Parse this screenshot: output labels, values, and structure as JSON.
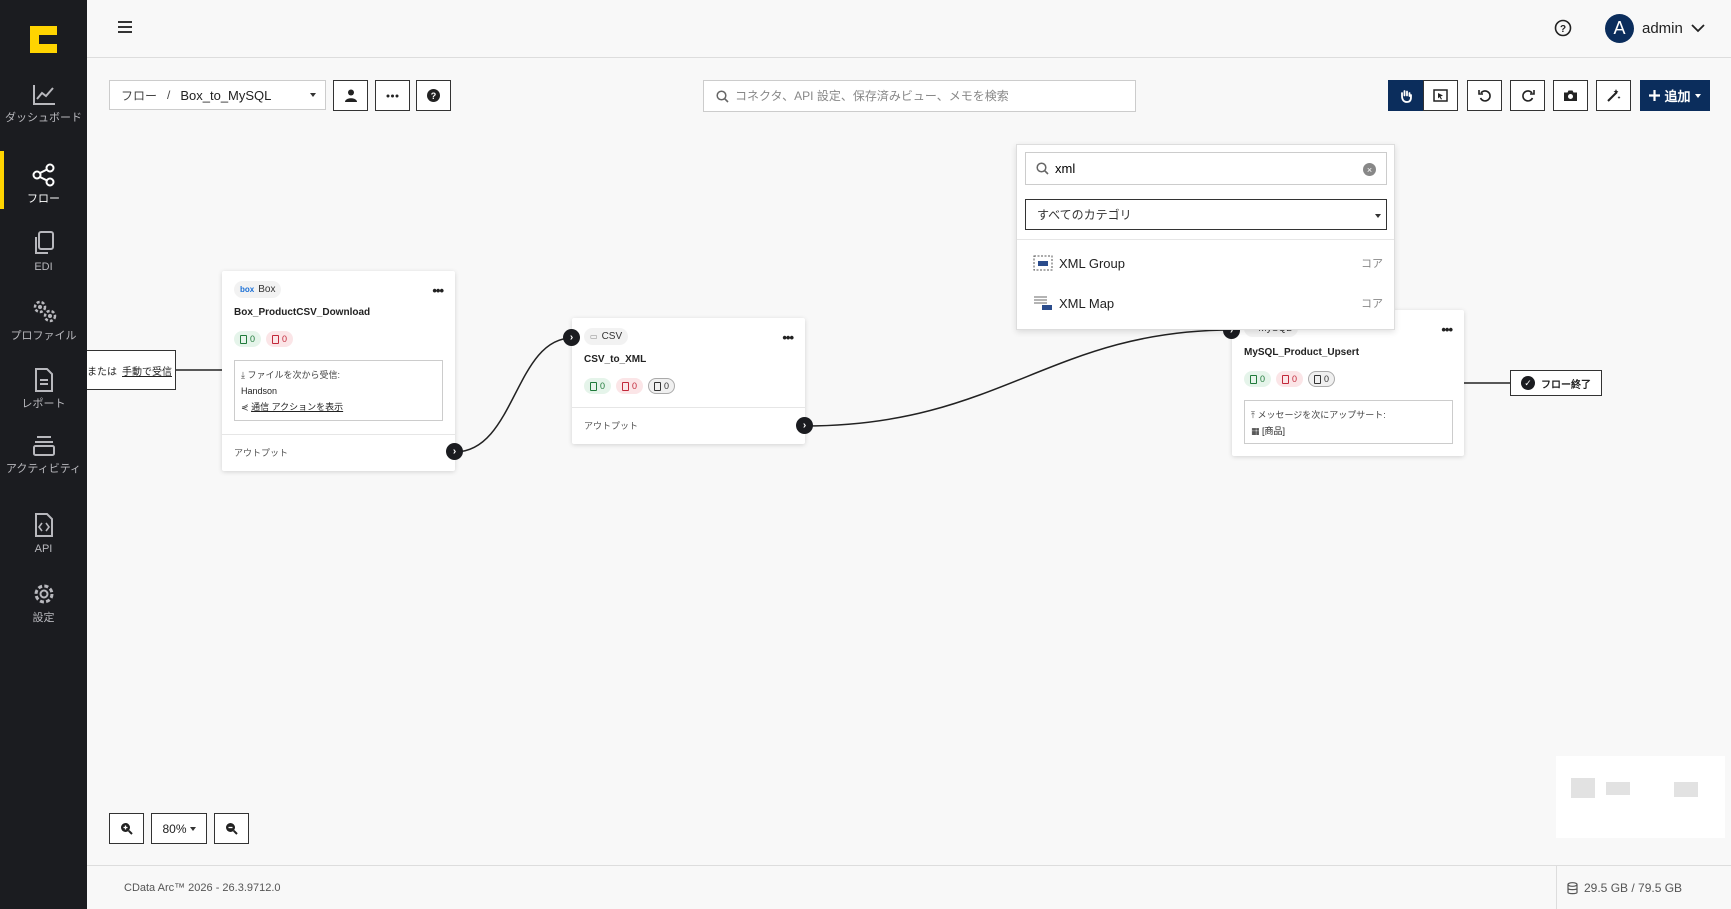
{
  "sidebar": {
    "items": [
      {
        "label": "ダッシュボード",
        "icon": "chart-line-icon"
      },
      {
        "label": "フロー",
        "icon": "share-nodes-icon",
        "active": true
      },
      {
        "label": "EDI",
        "icon": "documents-icon"
      },
      {
        "label": "プロファイル",
        "icon": "gears-icon"
      },
      {
        "label": "レポート",
        "icon": "report-icon"
      },
      {
        "label": "アクティビティ",
        "icon": "activity-stack-icon"
      },
      {
        "label": "API",
        "icon": "api-file-icon"
      },
      {
        "label": "設定",
        "icon": "gear-icon"
      }
    ]
  },
  "header": {
    "user": {
      "initial": "A",
      "name": "admin"
    }
  },
  "toolbar": {
    "breadcrumb_root": "フロー",
    "breadcrumb_sep": "/",
    "flow_name": "Box_to_MySQL",
    "search_placeholder": "コネクタ、API 設定、保存済みビュー、メモを検索",
    "add_label": "追加"
  },
  "canvas": {
    "trigger": {
      "prefix": "または",
      "link": "手動で受信"
    },
    "nodes": [
      {
        "connector": "Box",
        "title": "Box_ProductCSV_Download",
        "badges": {
          "ok": "0",
          "err": "0"
        },
        "info_line1": "ファイルを次から受信:",
        "info_line2": "Handson",
        "info_link": "通信 アクションを表示",
        "output": "アウトプット"
      },
      {
        "connector": "CSV",
        "title": "CSV_to_XML",
        "badges": {
          "ok": "0",
          "err": "0",
          "neutral": "0"
        },
        "output": "アウトプット"
      },
      {
        "connector": "MySQL",
        "title": "MySQL_Product_Upsert",
        "badges": {
          "ok": "0",
          "err": "0",
          "neutral": "0"
        },
        "info_line1": "メッセージを次にアップサート:",
        "info_line2": "[商品]"
      }
    ],
    "flow_end": "フロー終了"
  },
  "dropdown": {
    "search_value": "xml",
    "category_select": "すべてのカテゴリ",
    "results": [
      {
        "name": "XML Group",
        "category": "コア",
        "icon": "xml-group-icon"
      },
      {
        "name": "XML Map",
        "category": "コア",
        "icon": "xml-map-icon"
      }
    ]
  },
  "zoom": {
    "level": "80%"
  },
  "footer": {
    "version": "CData Arc™ 2026 - 26.3.9712.0",
    "storage": "29.5 GB / 79.5 GB"
  },
  "colors": {
    "sidebar": "#1b1c20",
    "accent": "#ffd400",
    "primary": "#0b2d5c"
  }
}
